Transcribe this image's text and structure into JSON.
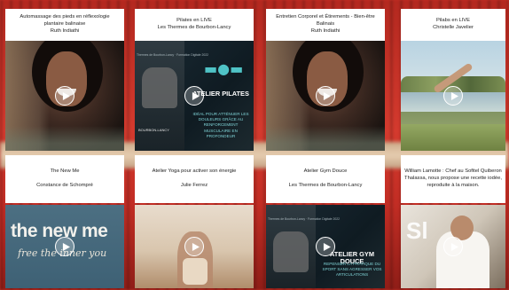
{
  "cards": [
    {
      "lines": [
        "Automassage des pieds en réflexologie",
        "plantaire balinaise",
        "Ruth Indiathi"
      ],
      "thumb": "portrait-woman-smiling",
      "play_icon": "play-icon"
    },
    {
      "lines": [
        "Pilates en LIVE",
        "Les Thermes de Bourbon-Lancy"
      ],
      "thumb": "pilates-poster",
      "poster": {
        "small": "Thermes de Bourbon-Lancy · Formation Digitale 2022",
        "title": "ATELIER PILATES",
        "sub": "IDÉAL POUR ATTÉNUER LES DOULEURS GRÂCE AU RENFORCEMENT MUSCULAIRE EN PROFONDEUR",
        "logo": "BOURBON-LANCY"
      },
      "play_icon": "play-icon"
    },
    {
      "lines": [
        "Entretien Corporel et Étirements - Bien-être",
        "Balinais",
        "Ruth Indiathi"
      ],
      "thumb": "portrait-woman-smiling",
      "play_icon": "play-icon"
    },
    {
      "lines": [
        "Pilabs en LIVE",
        "Christelle Javelier"
      ],
      "thumb": "yoga-by-lake",
      "play_icon": "play-icon"
    },
    {
      "lines": [
        "The New Me",
        "Constance de Schompré"
      ],
      "thumb": "the-new-me",
      "poster": {
        "big": "the new me",
        "script": "free the inner you"
      },
      "play_icon": "play-icon"
    },
    {
      "lines": [
        "Atelier Yoga pour activer son énergie",
        "Julie Ferrez"
      ],
      "thumb": "studio-woman",
      "play_icon": "play-icon"
    },
    {
      "lines": [
        "Atelier Gym Douce",
        "Les Thermes de Bourbon-Lancy"
      ],
      "thumb": "gym-douce-poster",
      "poster": {
        "small": "Thermes de Bourbon-Lancy · Formation Digitale 2022",
        "title": "ATELIER GYM DOUCE",
        "sub": "REPENSER LA PRATIQUE DU SPORT SANS AGRESSER VOS ARTICULATIONS",
        "logo": ""
      },
      "play_icon": "play-icon"
    },
    {
      "lines": [
        "William Lamotte : Chef au Sofitel Quiberon",
        "Thalassa, nous propose une recette iodée,",
        "reproduite à la maison."
      ],
      "thumb": "chef",
      "poster": {
        "letter": "Sl"
      },
      "play_icon": "play-icon"
    }
  ],
  "colors": {
    "background": "#c53027",
    "card_header": "#ffffff",
    "accent": "#4fc3c6"
  }
}
